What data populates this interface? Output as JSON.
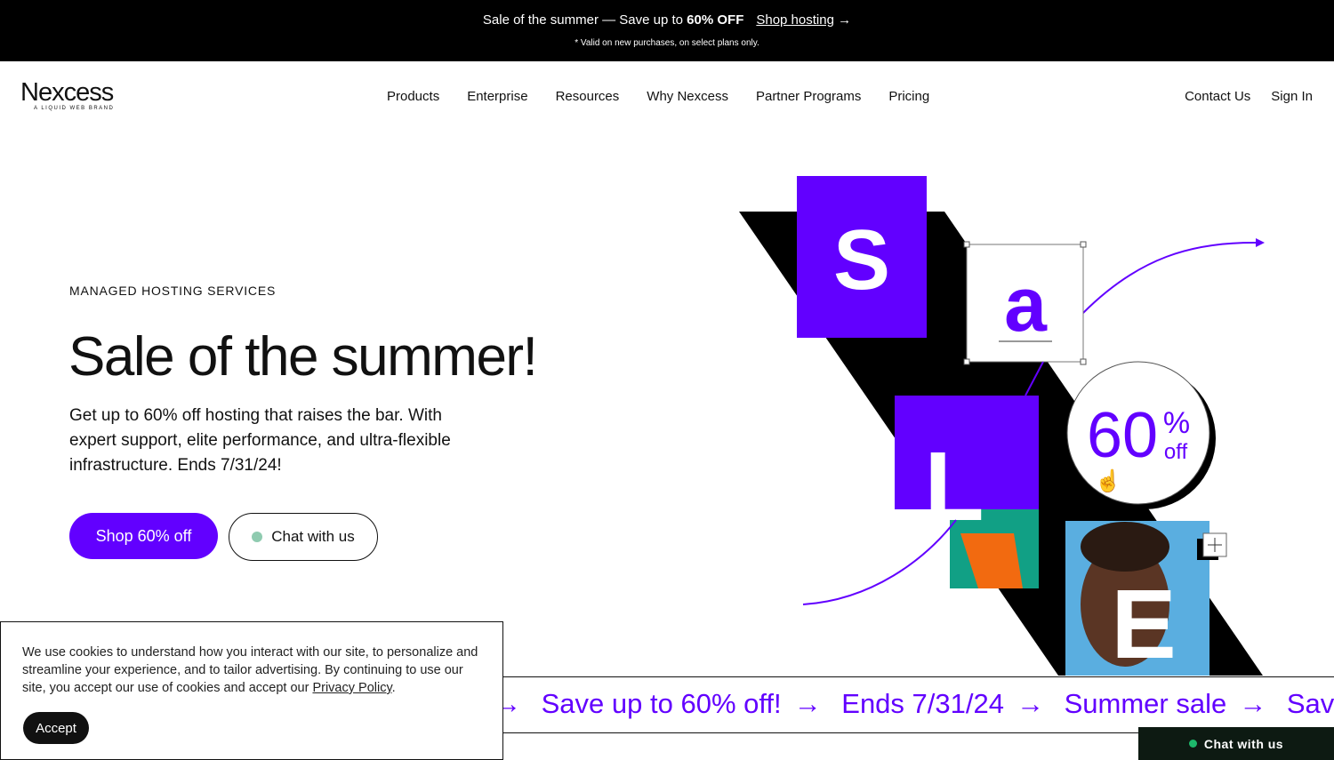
{
  "promo": {
    "text": "Sale of the summer — Save up to ",
    "bold": "60% OFF",
    "link": "Shop hosting",
    "arrow": "→",
    "note": "* Valid on new purchases, on select plans only."
  },
  "logo": {
    "name": "Nexcess",
    "tagline": "A LIQUID WEB BRAND"
  },
  "nav": {
    "items": [
      "Products",
      "Enterprise",
      "Resources",
      "Why Nexcess",
      "Partner Programs",
      "Pricing"
    ],
    "contact": "Contact Us",
    "signin": "Sign In"
  },
  "hero": {
    "eyebrow": "MANAGED HOSTING SERVICES",
    "title": "Sale of the summer!",
    "description": "Get up to 60% off hosting that raises the bar. With expert support, elite performance, and ultra-flexible infrastructure. Ends 7/31/24!",
    "primary": "Shop 60% off",
    "secondary": "Chat with us"
  },
  "art": {
    "letters": [
      "S",
      "a",
      "L",
      "E"
    ],
    "badge_big": "60",
    "badge_pct": "%",
    "badge_off": "off"
  },
  "band": {
    "items": [
      "Save up to 60% off!",
      "Ends 7/31/24",
      "Summer sale",
      "Save"
    ],
    "arrow": "→"
  },
  "cookie": {
    "text": "We use cookies to understand how you interact with our site, to personalize and streamline your experience, and to tailor advertising. By continuing to use our site, you accept our use of cookies and accept our ",
    "link": "Privacy Policy",
    "end": ".",
    "accept": "Accept"
  },
  "chat_widget": {
    "label": "Chat with us"
  },
  "colors": {
    "accent": "#6200ff",
    "promo_bg": "#000000",
    "chat_bg": "#0d1a12"
  }
}
